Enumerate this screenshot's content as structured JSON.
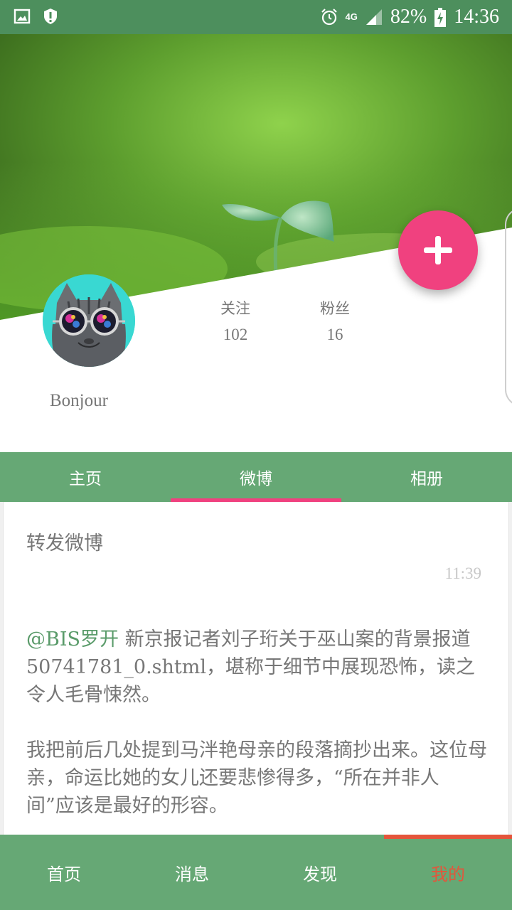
{
  "status_bar": {
    "network": "4G",
    "battery": "82%",
    "time": "14:36",
    "icons": [
      "image-icon",
      "shield-icon",
      "alarm-icon",
      "signal-icon",
      "battery-icon"
    ]
  },
  "profile": {
    "username": "Bonjour",
    "follow_label": "关注",
    "follow_count": "102",
    "fans_label": "粉丝",
    "fans_count": "16"
  },
  "tabs": [
    {
      "label": "主页",
      "active": false
    },
    {
      "label": "微博",
      "active": true
    },
    {
      "label": "相册",
      "active": false
    }
  ],
  "post": {
    "title": "转发微博",
    "time": "11:39",
    "mention": "@BIS罗开",
    "text1": " 新京报记者刘子珩关于巫山案的背景报道50741781_0.shtml，堪称于细节中展现恐怖，读之令人毛骨悚然。",
    "text2": "我把前后几处提到马泮艳母亲的段落摘抄出来。这位母亲，命运比她的女儿还要悲惨得多，“所在并非人间”应该是最好的形容。"
  },
  "bottom_nav": [
    {
      "label": "首页",
      "active": false
    },
    {
      "label": "消息",
      "active": false
    },
    {
      "label": "发现",
      "active": false
    },
    {
      "label": "我的",
      "active": true
    }
  ],
  "colors": {
    "primary": "#66a875",
    "status_bar": "#4d8f5d",
    "accent_pink": "#f0417f",
    "accent_red": "#e4553b"
  }
}
